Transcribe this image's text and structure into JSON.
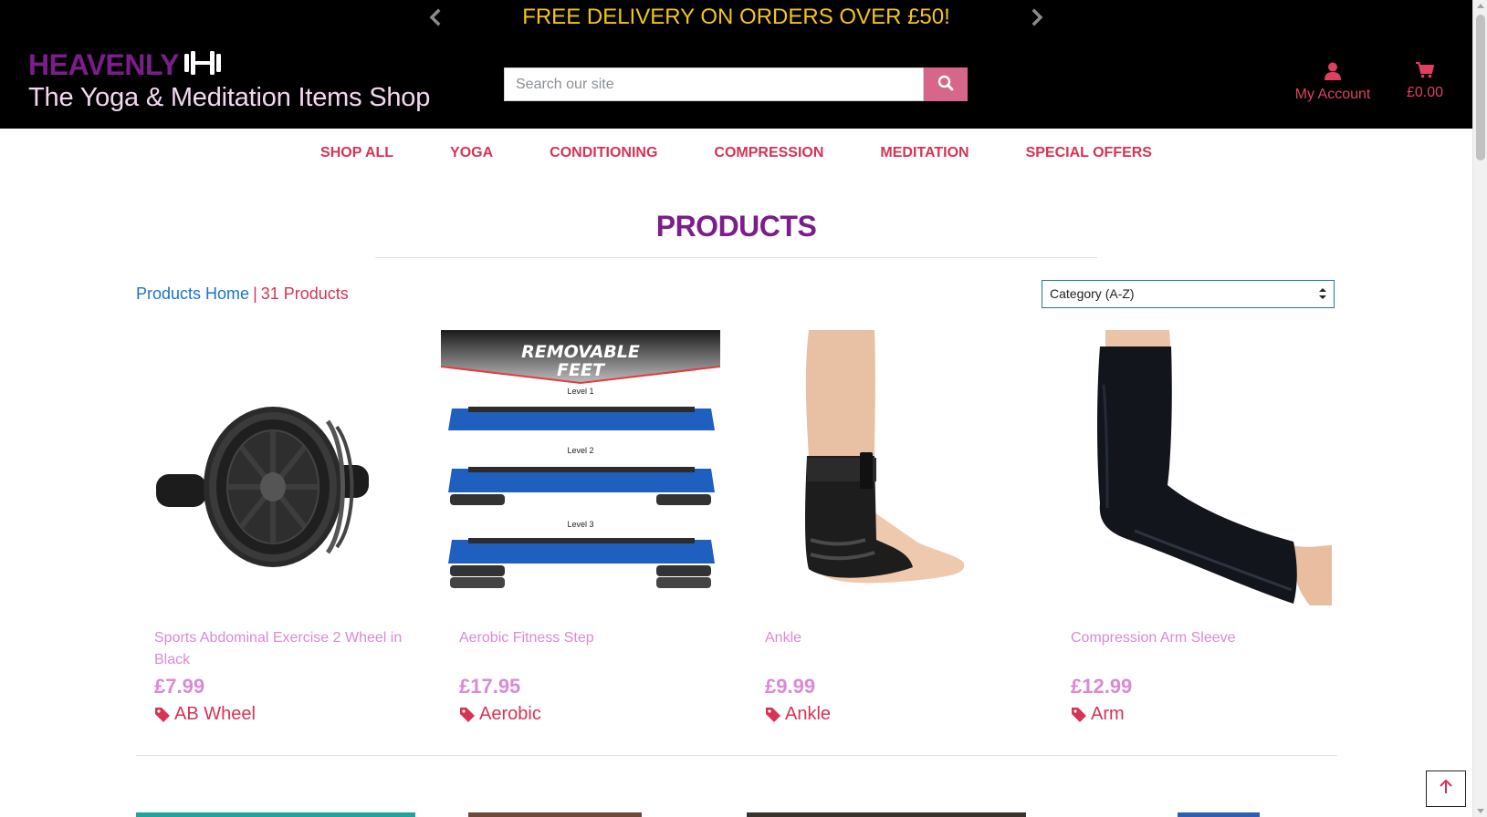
{
  "banner": {
    "message": "FREE DELIVERY ON ORDERS OVER £50!",
    "prev_icon": "chevron-left-icon",
    "next_icon": "chevron-right-icon"
  },
  "logo": {
    "brand": "HEAVENLY",
    "tagline": "The Yoga & Meditation Items Shop",
    "icon": "dumbbell-icon"
  },
  "search": {
    "placeholder": "Search our site",
    "value": "",
    "button_icon": "search-icon"
  },
  "account": {
    "label": "My Account",
    "icon": "user-icon"
  },
  "cart": {
    "total": "£0.00",
    "icon": "shopping-cart-icon"
  },
  "nav": {
    "items": [
      "SHOP ALL",
      "YOGA",
      "CONDITIONING",
      "COMPRESSION",
      "MEDITATION",
      "SPECIAL OFFERS"
    ]
  },
  "page": {
    "title": "PRODUCTS",
    "breadcrumb_home": "Products Home",
    "breadcrumb_sep": "|",
    "product_count": "31 Products",
    "sort_selected": "Category (A-Z)"
  },
  "products": [
    {
      "name": "Sports Abdominal Exercise 2 Wheel in Black",
      "price": "£7.99",
      "category": "AB Wheel"
    },
    {
      "name": "Aerobic Fitness Step",
      "price": "£17.95",
      "category": "Aerobic"
    },
    {
      "name": "Ankle",
      "price": "£9.99",
      "category": "Ankle"
    },
    {
      "name": "Compression Arm Sleeve",
      "price": "£12.99",
      "category": "Arm"
    }
  ],
  "aerobic_image_text": {
    "headline_1": "REMOVABLE",
    "headline_2": "FEET",
    "level_1": "Level 1",
    "level_2": "Level 2",
    "level_3": "Level 3"
  },
  "colors": {
    "header_bg": "#000000",
    "banner_text": "#f5c518",
    "brand_purple": "#7b1d8a",
    "accent_red": "#d63355",
    "link_blue": "#1a73c9",
    "product_pink": "#d98ad4",
    "search_button": "#d6678a"
  },
  "back_to_top_icon": "arrow-up-icon"
}
